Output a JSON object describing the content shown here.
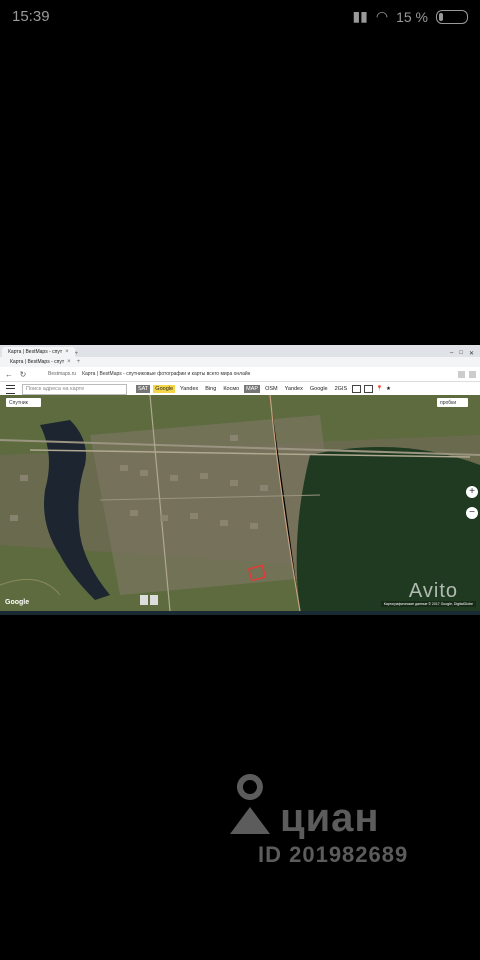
{
  "status": {
    "time": "15:39",
    "battery": "15 %"
  },
  "browser": {
    "tab1": "Карта | BestMaps - спут",
    "tab2": "Карта | BestMaps - спут",
    "url": "Bestmaps.ru",
    "page_title": "Карта | BestMaps - спутниковые фотографии и карты всего мира онлайн"
  },
  "toolbar": {
    "search_placeholder": "Поиск адреса на карте",
    "sat_label": "SAT",
    "sat_sources": [
      "Google",
      "Yandex",
      "Bing",
      "Космо"
    ],
    "map_label": "MAP",
    "map_sources": [
      "OSM",
      "Yandex",
      "Google",
      "2GIS"
    ]
  },
  "map": {
    "scheme_select": "Спутник",
    "traffic": "пробки",
    "zoom_in": "+",
    "zoom_out": "−",
    "google": "Google",
    "attribution": "Картографические данные © 2017 Google, DigitalGlobe",
    "watermark": "Avito"
  },
  "watermark": {
    "brand": "циан",
    "listing_id": "ID 201982689"
  },
  "colors": {
    "selected_source": "#f5d54a",
    "plot_outline": "#e53935"
  }
}
